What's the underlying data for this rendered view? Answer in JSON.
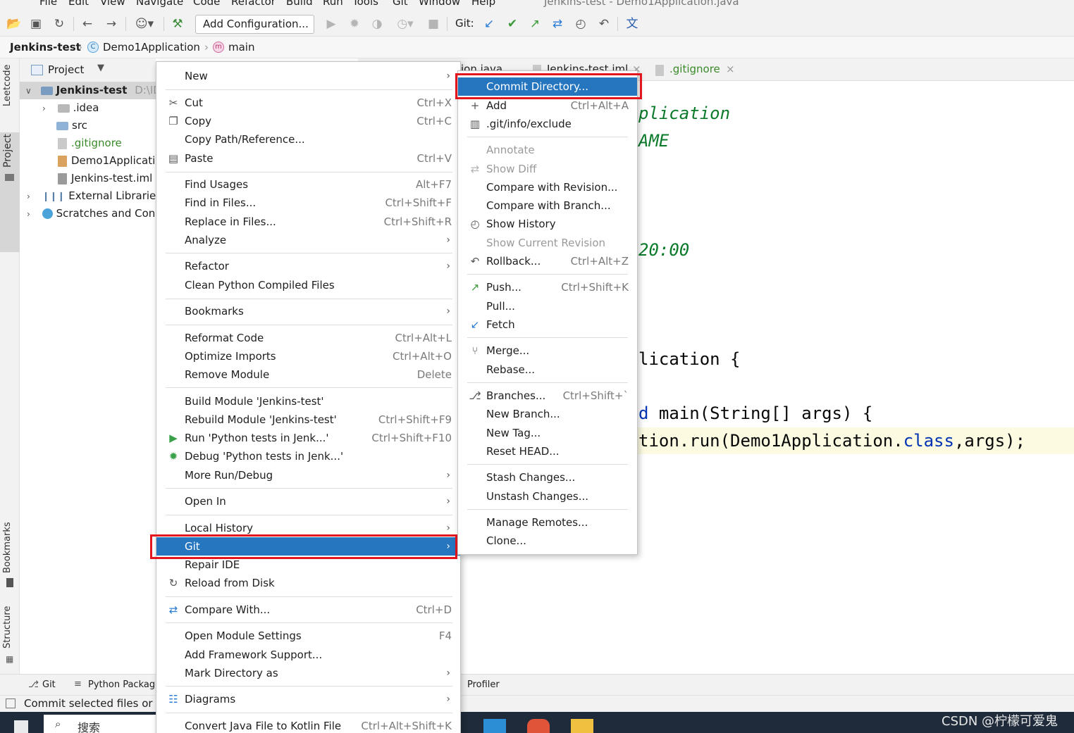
{
  "menubar": {
    "items": [
      "File",
      "Edit",
      "View",
      "Navigate",
      "Code",
      "Refactor",
      "Build",
      "Run",
      "Tools",
      "Git",
      "Window",
      "Help"
    ],
    "window_title": "Jenkins-test - Demo1Application.java"
  },
  "toolbar": {
    "add_configuration": "Add Configuration...",
    "git_label": "Git:"
  },
  "breadcrumb": {
    "project": "Jenkins-test",
    "class": "Demo1Application",
    "method": "main"
  },
  "left_strip": {
    "leetcode": "Leetcode",
    "project": "Project",
    "bookmarks": "Bookmarks",
    "structure": "Structure"
  },
  "project_panel": {
    "title": "Project",
    "root_name": "Jenkins-test",
    "root_path": "D:\\IDE",
    "items": [
      ".idea",
      "src",
      ".gitignore",
      "Demo1Applicati",
      "Jenkins-test.iml",
      "External Libraries",
      "Scratches and Cons"
    ]
  },
  "editor": {
    "tabs": [
      "ion.java",
      "Jenkins-test.iml",
      ".gitignore"
    ],
    "lines": {
      "l1": "plication",
      "l2": "AME",
      "l3": "20:00",
      "l4": "lication {",
      "l5_kw": "d",
      "l5": " main(String[] args) {",
      "l6a": "tion.run(Demo1Application.",
      "l6_kw": "class",
      "l6b": ",args);"
    }
  },
  "context_menu": {
    "items": [
      {
        "label": "New",
        "shortcut": "",
        "submenu": true
      },
      {
        "label": "Cut",
        "shortcut": "Ctrl+X"
      },
      {
        "label": "Copy",
        "shortcut": "Ctrl+C"
      },
      {
        "label": "Copy Path/Reference...",
        "shortcut": ""
      },
      {
        "label": "Paste",
        "shortcut": "Ctrl+V"
      },
      {
        "label": "Find Usages",
        "shortcut": "Alt+F7"
      },
      {
        "label": "Find in Files...",
        "shortcut": "Ctrl+Shift+F"
      },
      {
        "label": "Replace in Files...",
        "shortcut": "Ctrl+Shift+R"
      },
      {
        "label": "Analyze",
        "shortcut": "",
        "submenu": true
      },
      {
        "label": "Refactor",
        "shortcut": "",
        "submenu": true
      },
      {
        "label": "Clean Python Compiled Files",
        "shortcut": ""
      },
      {
        "label": "Bookmarks",
        "shortcut": "",
        "submenu": true
      },
      {
        "label": "Reformat Code",
        "shortcut": "Ctrl+Alt+L"
      },
      {
        "label": "Optimize Imports",
        "shortcut": "Ctrl+Alt+O"
      },
      {
        "label": "Remove Module",
        "shortcut": "Delete"
      },
      {
        "label": "Build Module 'Jenkins-test'",
        "shortcut": ""
      },
      {
        "label": "Rebuild Module 'Jenkins-test'",
        "shortcut": "Ctrl+Shift+F9"
      },
      {
        "label": "Run 'Python tests in Jenk...'",
        "shortcut": "Ctrl+Shift+F10"
      },
      {
        "label": "Debug 'Python tests in Jenk...'",
        "shortcut": ""
      },
      {
        "label": "More Run/Debug",
        "shortcut": "",
        "submenu": true
      },
      {
        "label": "Open In",
        "shortcut": "",
        "submenu": true
      },
      {
        "label": "Local History",
        "shortcut": "",
        "submenu": true
      },
      {
        "label": "Git",
        "shortcut": "",
        "submenu": true,
        "highlighted": true
      },
      {
        "label": "Repair IDE",
        "shortcut": ""
      },
      {
        "label": "Reload from Disk",
        "shortcut": ""
      },
      {
        "label": "Compare With...",
        "shortcut": "Ctrl+D"
      },
      {
        "label": "Open Module Settings",
        "shortcut": "F4"
      },
      {
        "label": "Add Framework Support...",
        "shortcut": ""
      },
      {
        "label": "Mark Directory as",
        "shortcut": "",
        "submenu": true
      },
      {
        "label": "Diagrams",
        "shortcut": "",
        "submenu": true
      },
      {
        "label": "Convert Java File to Kotlin File",
        "shortcut": "Ctrl+Alt+Shift+K"
      }
    ]
  },
  "git_menu": {
    "items": [
      {
        "label": "Commit Directory...",
        "shortcut": "",
        "highlighted": true
      },
      {
        "label": "Add",
        "shortcut": "Ctrl+Alt+A"
      },
      {
        "label": ".git/info/exclude",
        "shortcut": ""
      },
      {
        "label": "Annotate",
        "shortcut": "",
        "disabled": true
      },
      {
        "label": "Show Diff",
        "shortcut": "",
        "disabled": true
      },
      {
        "label": "Compare with Revision...",
        "shortcut": ""
      },
      {
        "label": "Compare with Branch...",
        "shortcut": ""
      },
      {
        "label": "Show History",
        "shortcut": ""
      },
      {
        "label": "Show Current Revision",
        "shortcut": "",
        "disabled": true
      },
      {
        "label": "Rollback...",
        "shortcut": "Ctrl+Alt+Z"
      },
      {
        "label": "Push...",
        "shortcut": "Ctrl+Shift+K"
      },
      {
        "label": "Pull...",
        "shortcut": ""
      },
      {
        "label": "Fetch",
        "shortcut": ""
      },
      {
        "label": "Merge...",
        "shortcut": ""
      },
      {
        "label": "Rebase...",
        "shortcut": ""
      },
      {
        "label": "Branches...",
        "shortcut": "Ctrl+Shift+`"
      },
      {
        "label": "New Branch...",
        "shortcut": ""
      },
      {
        "label": "New Tag...",
        "shortcut": ""
      },
      {
        "label": "Reset HEAD...",
        "shortcut": ""
      },
      {
        "label": "Stash Changes...",
        "shortcut": ""
      },
      {
        "label": "Unstash Changes...",
        "shortcut": ""
      },
      {
        "label": "Manage Remotes...",
        "shortcut": ""
      },
      {
        "label": "Clone...",
        "shortcut": ""
      }
    ]
  },
  "bottom_bar": {
    "git": "Git",
    "python_packages": "Python Package",
    "profiler": "Profiler"
  },
  "status_bar": {
    "text": "Commit selected files or c"
  },
  "taskbar": {
    "search": "搜索"
  },
  "watermark": "CSDN @柠檬可爱鬼",
  "colors": {
    "highlight": "#2675bf",
    "annotation_box": "#e3151e",
    "code_green": "#0a7a2a",
    "keyword_blue": "#0033b3"
  }
}
